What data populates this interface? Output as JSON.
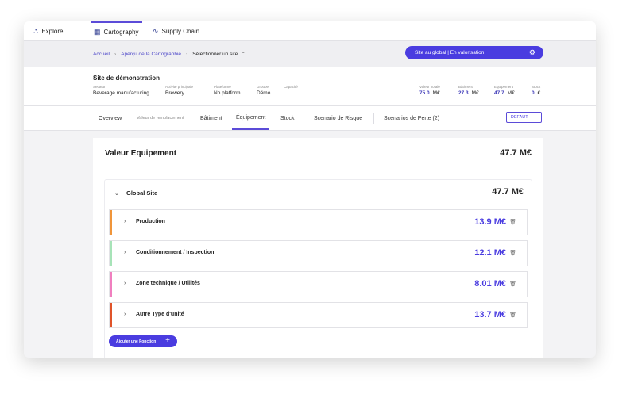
{
  "topnav": {
    "items": [
      {
        "label": "Explore",
        "icon": "explore-icon"
      },
      {
        "label": "Cartography",
        "icon": "map-icon"
      },
      {
        "label": "Supply Chain",
        "icon": "supply-chain-icon"
      }
    ],
    "active": "Cartography"
  },
  "breadcrumb": {
    "home": "Accueil",
    "overview": "Aperçu de la Cartographie",
    "current": "Sélectionner un site"
  },
  "site_button": {
    "label": "Site au global | En valorisation"
  },
  "site": {
    "title": "Site de démonstration",
    "fields": [
      {
        "label": "Secteur",
        "value": "Beverage manufacturing"
      },
      {
        "label": "Activité principale",
        "value": "Brewery"
      },
      {
        "label": "Plateforme",
        "value": "No platform"
      },
      {
        "label": "Groupe",
        "value": "Démo"
      },
      {
        "label": "Capacité",
        "value": ""
      }
    ],
    "kpis": [
      {
        "label": "Valeur Totale",
        "value": "75.0",
        "unit": "M€"
      },
      {
        "label": "Bâtiment",
        "value": "27.3",
        "unit": "M€"
      },
      {
        "label": "Equipement",
        "value": "47.7",
        "unit": "M€"
      },
      {
        "label": "Stock",
        "value": "0",
        "unit": "€"
      }
    ]
  },
  "tabs": {
    "overview": "Overview",
    "replacement_label": "Valeur de remplacement",
    "batiment": "Bâtiment",
    "equipement": "Équipement",
    "stock": "Stock",
    "risk": "Scenario de Risque",
    "loss": "Scenarios de Perte (2)",
    "default_btn": "DEFAUT",
    "default_icon": "⋮"
  },
  "card": {
    "title": "Valeur Equipement",
    "value": "47.7 M€",
    "global": {
      "label": "Global Site",
      "value": "47.7 M€"
    },
    "rows": [
      {
        "label": "Production",
        "value": "13.9 M€",
        "color": "#f0953a"
      },
      {
        "label": "Conditionnement / Inspection",
        "value": "12.1 M€",
        "color": "#a7e3b8"
      },
      {
        "label": "Zone technique / Utilités",
        "value": "8.01 M€",
        "color": "#f07fbf"
      },
      {
        "label": "Autre Type d'unité",
        "value": "13.7 M€",
        "color": "#e0542a"
      }
    ],
    "add_button": "Ajouter une Fonction"
  }
}
